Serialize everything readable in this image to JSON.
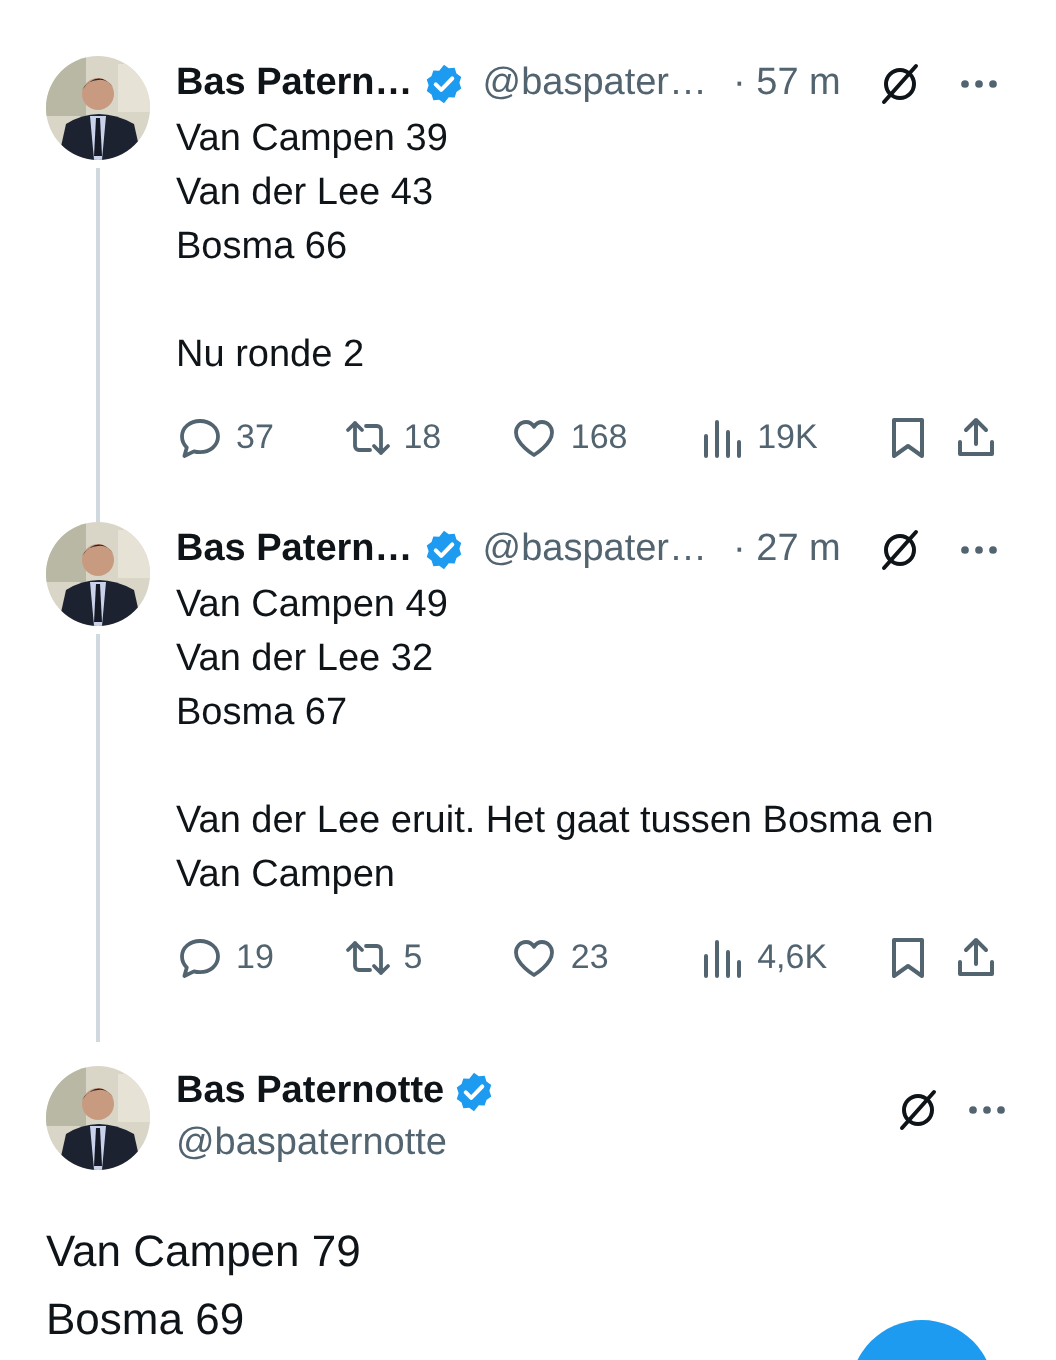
{
  "tweets": [
    {
      "kind": "thread",
      "author": {
        "name": "Bas Patern…",
        "handle": "@baspater…",
        "verified": true
      },
      "time": "· 57 m",
      "paragraphs": [
        [
          "Van Campen 39",
          "Van der Lee 43",
          "Bosma 66"
        ],
        [
          "Nu ronde 2"
        ]
      ],
      "actions": [
        {
          "kind": "reply",
          "count": "37"
        },
        {
          "kind": "repost",
          "count": "18"
        },
        {
          "kind": "like",
          "count": "168"
        },
        {
          "kind": "views",
          "count": "19K"
        },
        {
          "kind": "bookmark"
        },
        {
          "kind": "share"
        }
      ]
    },
    {
      "kind": "thread",
      "author": {
        "name": "Bas Patern…",
        "handle": "@baspater…",
        "verified": true
      },
      "time": "· 27 m",
      "paragraphs": [
        [
          "Van Campen 49",
          "Van der Lee 32",
          "Bosma 67"
        ],
        [
          "Van der Lee eruit. Het gaat tussen Bosma en Van Campen"
        ]
      ],
      "actions": [
        {
          "kind": "reply",
          "count": "19"
        },
        {
          "kind": "repost",
          "count": "5"
        },
        {
          "kind": "like",
          "count": "23"
        },
        {
          "kind": "views",
          "count": "4,6K"
        },
        {
          "kind": "bookmark"
        },
        {
          "kind": "share"
        }
      ]
    },
    {
      "kind": "focused",
      "author": {
        "name": "Bas Paternotte",
        "handle": "@baspaternotte",
        "verified": true
      },
      "paragraphs": [
        [
          "Van Campen 79",
          "Bosma 69"
        ]
      ]
    }
  ],
  "floating_button": {
    "kind": "compose"
  }
}
